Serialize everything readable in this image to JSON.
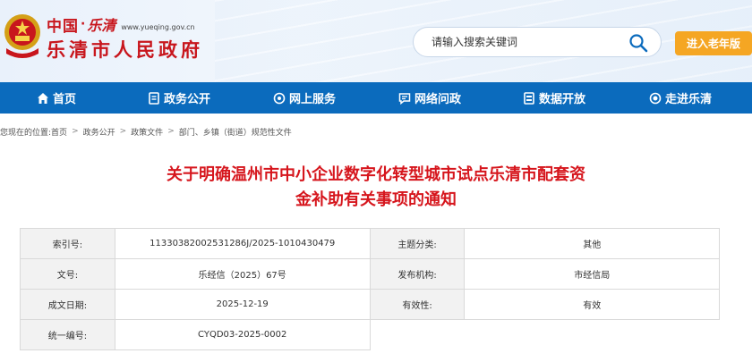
{
  "header": {
    "site_top_china": "中国",
    "site_top_dot": "·",
    "site_top_script": "乐清",
    "domain": "www.yueqing.gov.cn",
    "site_name": "乐清市人民政府",
    "search_placeholder": "请输入搜索关键词",
    "elder_mode_label": "进入老年版"
  },
  "nav": {
    "items": [
      {
        "label": "首页",
        "icon": "home-icon"
      },
      {
        "label": "政务公开",
        "icon": "document-icon"
      },
      {
        "label": "网上服务",
        "icon": "service-icon"
      },
      {
        "label": "网络问政",
        "icon": "chat-icon"
      },
      {
        "label": "数据开放",
        "icon": "data-icon"
      },
      {
        "label": "走进乐清",
        "icon": "eye-icon"
      }
    ]
  },
  "breadcrumb": {
    "prefix": "您现在的位置:",
    "items": [
      "首页",
      "政务公开",
      "政策文件",
      "部门、乡镇（街道）规范性文件"
    ],
    "separator": ">"
  },
  "document": {
    "title_line1": "关于明确温州市中小企业数字化转型城市试点乐清市配套资",
    "title_line2": "金补助有关事项的通知"
  },
  "info_table": {
    "index_no_label": "索引号:",
    "index_no": "11330382002531286J/2025-1010430479",
    "category_label": "主题分类:",
    "category": "其他",
    "doc_no_label": "文号:",
    "doc_no": "乐经信（2025）67号",
    "issuer_label": "发布机构:",
    "issuer": "市经信局",
    "date_label": "成文日期:",
    "date": "2025-12-19",
    "validity_label": "有效性:",
    "validity": "有效",
    "unified_no_label": "统一编号:",
    "unified_no": "CYQD03-2025-0002"
  },
  "colors": {
    "brand_red": "#c8161d",
    "nav_blue": "#0b6bbd",
    "elder_orange": "#f5a623"
  }
}
